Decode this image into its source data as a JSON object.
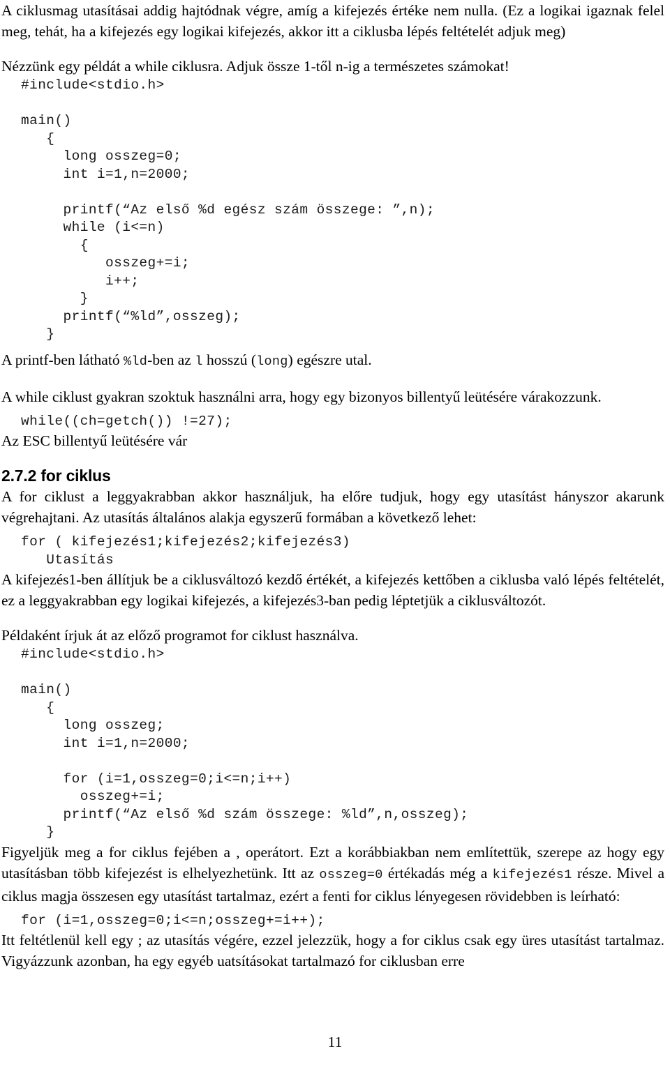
{
  "document": {
    "page_number": "11",
    "blocks": {
      "intro_paragraph": "A ciklusmag utasításai addig hajtódnak végre, amíg a kifejezés értéke nem nulla. (Ez a logikai igaznak felel meg, tehát, ha a kifejezés egy logikai kifejezés, akkor itt a ciklusba lépés feltételét adjuk meg)",
      "example_lead": "Nézzünk egy példát a while ciklusra. Adjuk össze 1-től n-ig a természetes számokat!",
      "code_while": "#include<stdio.h>\n\nmain()\n   {\n     long osszeg=0;\n     int i=1,n=2000;\n\n     printf(“Az első %d egész szám összege: ”,n);\n     while (i<=n)\n       {\n          osszeg+=i;\n          i++;\n       }\n     printf(“%ld”,osszeg);\n   }",
      "printf_note": {
        "t1": "A printf-ben látható ",
        "c1": "%ld",
        "t2": "-ben az ",
        "c2": "l",
        "t3": " hosszú (",
        "c3": "long",
        "t4": ") egészre utal."
      },
      "while_usage_paragraph": "A while ciklust gyakran szoktuk használni arra, hogy egy bizonyos billentyű leütésére várakozzunk.",
      "code_getch": "while((ch=getch()) !=27);",
      "esc_note": "Az ESC billentyű leütésére vár",
      "heading_272": "2.7.2  for ciklus",
      "for_intro_paragraph": "A for ciklust a leggyakrabban akkor használjuk, ha előre tudjuk, hogy egy utasítást hányszor akarunk végrehajtani. Az utasítás általános alakja egyszerű formában a következő lehet:",
      "code_for_general": "for ( kifejezés1;kifejezés2;kifejezés3)\n   Utasítás",
      "for_explanation_paragraph": "A kifejezés1-ben állítjuk be a ciklusváltozó kezdő értékét, a kifejezés kettőben a ciklusba való lépés feltételét, ez a leggyakrabban egy logikai kifejezés, a kifejezés3-ban pedig léptetjük a ciklusváltozót.",
      "rewrite_lead": "Példaként írjuk át az előző programot for ciklust használva.",
      "code_for_program": "#include<stdio.h>\n\nmain()\n   {\n     long osszeg;\n     int i=1,n=2000;\n\n     for (i=1,osszeg=0;i<=n;i++)\n       osszeg+=i;\n     printf(“Az első %d szám összege: %ld”,n,osszeg);\n   }",
      "comma_operator_paragraph": {
        "t1": "Figyeljük meg a for ciklus fejében a , operátort. Ezt a korábbiakban nem említettük, szerepe az hogy egy utasításban több kifejezést is elhelyezhetünk. Itt az ",
        "c1": "osszeg=0",
        "t2": " értékadás még a ",
        "c2": "kifejezés1",
        "t3": " része. Mivel a ciklus magja összesen egy utasítást tartalmaz, ezért a fenti for ciklus lényegesen rövidebben is leírható:"
      },
      "code_for_short": "for (i=1,osszeg=0;i<=n;osszeg+=i++);",
      "closing_paragraph": "Itt feltétlenül kell egy ; az utasítás végére, ezzel jelezzük, hogy a for ciklus csak egy üres utasítást tartalmaz. Vigyázzunk azonban, ha egy egyéb uatsításokat tartalmazó for ciklusban erre"
    }
  }
}
